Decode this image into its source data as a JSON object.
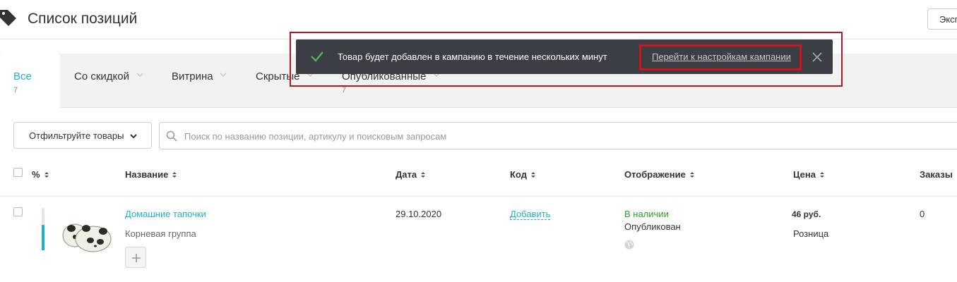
{
  "header": {
    "title": "Список позиций",
    "export_label": "Экспорт"
  },
  "tabs": [
    {
      "label": "Все",
      "count": "7"
    },
    {
      "label": "Со скидкой"
    },
    {
      "label": "Витрина"
    },
    {
      "label": "Скрытые"
    },
    {
      "label": "Опубликованные",
      "count": "7"
    }
  ],
  "toast": {
    "message": "Товар будет добавлен в кампанию в течение нескольких минут",
    "link": "Перейти к настройкам кампании"
  },
  "filter": {
    "label": "Отфильтруйте товары"
  },
  "search": {
    "placeholder": "Поиск по названию позиции, артикулу и поисковым запросам"
  },
  "table": {
    "columns": [
      "%",
      "Название",
      "Дата",
      "Код",
      "Отображение",
      "Цена",
      "Заказы"
    ],
    "rows": [
      {
        "name": "Домашние тапочки",
        "group": "Корневая группа",
        "date": "29.10.2020",
        "code_action": "Добавить",
        "availability": "В наличии",
        "status": "Опубликован",
        "price": "46 руб.",
        "price_type": "Розница",
        "orders": "0",
        "completeness": 0.6
      }
    ]
  },
  "colors": {
    "accent": "#1fb2c4",
    "toast_bg": "#3b3e45",
    "highlight": "#d0141a",
    "in_stock": "#2ca02c"
  }
}
